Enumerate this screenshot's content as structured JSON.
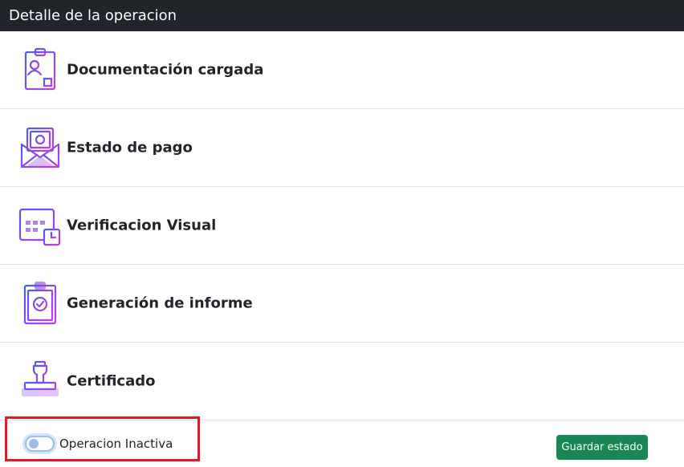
{
  "header": {
    "title": "Detalle de la operacion"
  },
  "items": [
    {
      "label": "Documentación cargada",
      "icon": "document-badge-icon"
    },
    {
      "label": "Estado de pago",
      "icon": "payment-envelope-icon"
    },
    {
      "label": "Verificacion Visual",
      "icon": "calendar-clock-icon"
    },
    {
      "label": "Generación de informe",
      "icon": "clipboard-check-icon"
    },
    {
      "label": "Certificado",
      "icon": "stamp-icon"
    }
  ],
  "footer": {
    "toggle_label": "Operacion Inactiva",
    "toggle_checked": false,
    "save_label": "Guardar estado"
  },
  "colors": {
    "header_bg": "#212529",
    "icon_gradient_start": "#4c5cf0",
    "icon_gradient_end": "#c83ae0",
    "save_button": "#198754",
    "highlight_border": "#e01b24"
  }
}
